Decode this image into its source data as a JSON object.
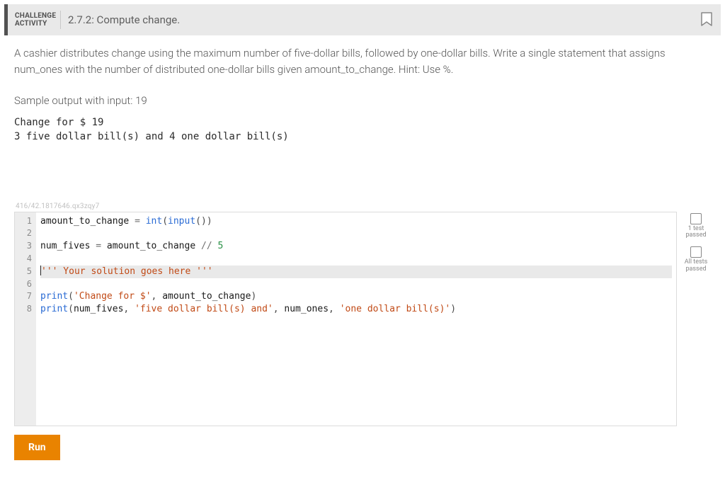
{
  "header": {
    "badge_line1": "CHALLENGE",
    "badge_line2": "ACTIVITY",
    "title": "2.7.2: Compute change."
  },
  "prompt": "A cashier distributes change using the maximum number of five-dollar bills, followed by one-dollar bills. Write a single statement that assigns num_ones with the number of distributed one-dollar bills given amount_to_change. Hint: Use %.",
  "sample_label": "Sample output with input: 19",
  "sample_output": "Change for $ 19\n3 five dollar bill(s) and 4 one dollar bill(s)",
  "watermark": "416/42.1817646.qx3zqy7",
  "editor": {
    "lines": [
      [
        {
          "t": "amount_to_change ",
          "c": "tok-id"
        },
        {
          "t": "=",
          "c": "tok-op"
        },
        {
          "t": " ",
          "c": ""
        },
        {
          "t": "int",
          "c": "tok-fn"
        },
        {
          "t": "(",
          "c": "tok-pn"
        },
        {
          "t": "input",
          "c": "tok-fn"
        },
        {
          "t": "()",
          "c": "tok-pn"
        },
        {
          "t": ")",
          "c": "tok-pn"
        }
      ],
      [],
      [
        {
          "t": "num_fives ",
          "c": "tok-id"
        },
        {
          "t": "=",
          "c": "tok-op"
        },
        {
          "t": " amount_to_change ",
          "c": "tok-id"
        },
        {
          "t": "//",
          "c": "tok-op"
        },
        {
          "t": " ",
          "c": ""
        },
        {
          "t": "5",
          "c": "tok-num"
        }
      ],
      [],
      [
        {
          "t": "'''",
          "c": "tok-cm"
        },
        {
          "t": " Your solution goes here ",
          "c": "tok-cm"
        },
        {
          "t": "'''",
          "c": "tok-cm"
        }
      ],
      [],
      [
        {
          "t": "print",
          "c": "tok-fn"
        },
        {
          "t": "(",
          "c": "tok-pn"
        },
        {
          "t": "'Change for $'",
          "c": "tok-str"
        },
        {
          "t": ",",
          "c": "tok-pn"
        },
        {
          "t": " amount_to_change",
          "c": "tok-id"
        },
        {
          "t": ")",
          "c": "tok-pn"
        }
      ],
      [
        {
          "t": "print",
          "c": "tok-fn"
        },
        {
          "t": "(",
          "c": "tok-pn"
        },
        {
          "t": "num_fives",
          "c": "tok-id"
        },
        {
          "t": ",",
          "c": "tok-pn"
        },
        {
          "t": " ",
          "c": ""
        },
        {
          "t": "'five dollar bill(s) and'",
          "c": "tok-str"
        },
        {
          "t": ",",
          "c": "tok-pn"
        },
        {
          "t": " num_ones",
          "c": "tok-id"
        },
        {
          "t": ",",
          "c": "tok-pn"
        },
        {
          "t": " ",
          "c": ""
        },
        {
          "t": "'one dollar bill(s)'",
          "c": "tok-str"
        },
        {
          "t": ")",
          "c": "tok-pn"
        }
      ]
    ],
    "active_line_index": 4,
    "cursor_line_index": 4,
    "cursor_before_token_index": 0
  },
  "side": {
    "item1_line1": "1 test",
    "item1_line2": "passed",
    "item2_line1": "All tests",
    "item2_line2": "passed"
  },
  "run_label": "Run"
}
